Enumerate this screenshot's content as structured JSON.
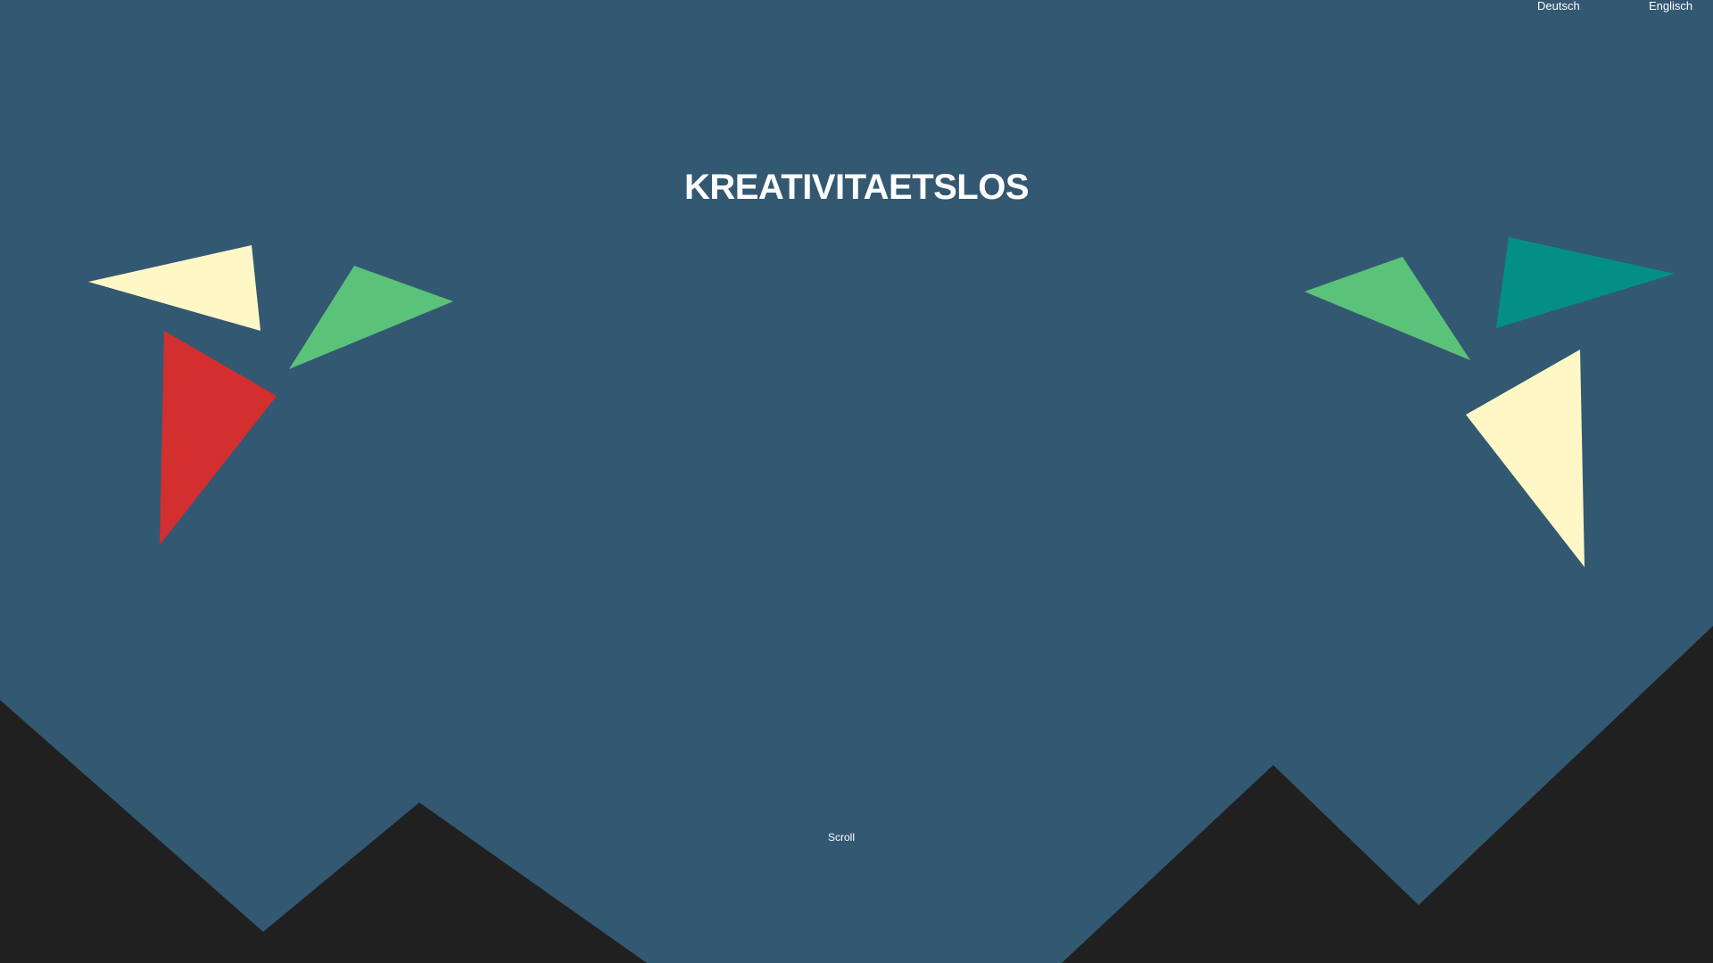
{
  "nav": {
    "languages": [
      {
        "label": "Deutsch"
      },
      {
        "label": "Englisch"
      }
    ]
  },
  "hero": {
    "title": "KREATIVITAETSLOS",
    "scroll_label": "Scroll"
  },
  "colors": {
    "background": "#335872",
    "ground": "#202020",
    "cream": "#FFF8C6",
    "green": "#5BC27A",
    "red": "#D32F2F",
    "teal": "#048F86",
    "text": "#FFFFFF"
  },
  "decorations": {
    "left_triangles": [
      "cream",
      "green",
      "red"
    ],
    "right_triangles": [
      "green",
      "teal",
      "cream"
    ],
    "ground": "mountain silhouette"
  }
}
